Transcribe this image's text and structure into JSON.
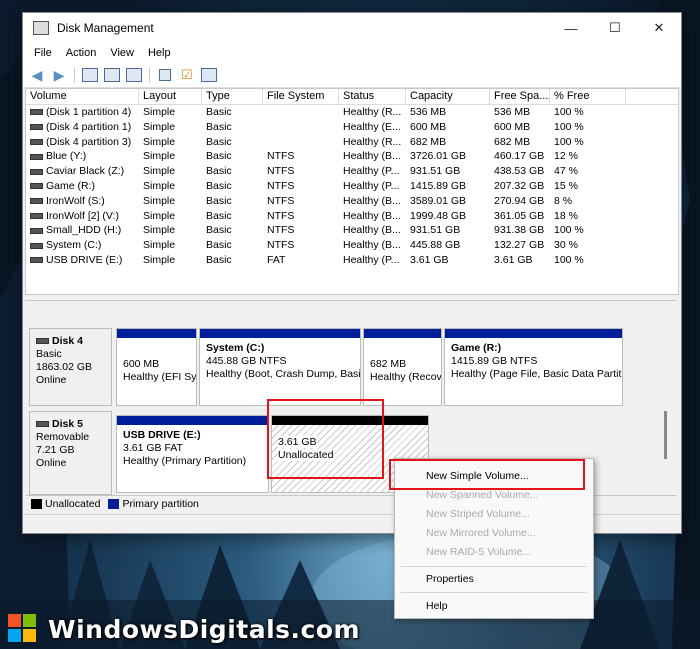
{
  "window": {
    "title": "Disk Management",
    "controls": [
      "—",
      "☐",
      "✕"
    ]
  },
  "menu": [
    "File",
    "Action",
    "View",
    "Help"
  ],
  "columns": [
    "Volume",
    "Layout",
    "Type",
    "File System",
    "Status",
    "Capacity",
    "Free Spa...",
    "% Free"
  ],
  "volumes": [
    [
      "(Disk 1 partition 4)",
      "Simple",
      "Basic",
      "",
      "Healthy (R...",
      "536 MB",
      "536 MB",
      "100 %"
    ],
    [
      "(Disk 4 partition 1)",
      "Simple",
      "Basic",
      "",
      "Healthy (E...",
      "600 MB",
      "600 MB",
      "100 %"
    ],
    [
      "(Disk 4 partition 3)",
      "Simple",
      "Basic",
      "",
      "Healthy (R...",
      "682 MB",
      "682 MB",
      "100 %"
    ],
    [
      "Blue (Y:)",
      "Simple",
      "Basic",
      "NTFS",
      "Healthy (B...",
      "3726.01 GB",
      "460.17 GB",
      "12 %"
    ],
    [
      "Caviar Black (Z:)",
      "Simple",
      "Basic",
      "NTFS",
      "Healthy (P...",
      "931.51 GB",
      "438.53 GB",
      "47 %"
    ],
    [
      "Game (R:)",
      "Simple",
      "Basic",
      "NTFS",
      "Healthy (P...",
      "1415.89 GB",
      "207.32 GB",
      "15 %"
    ],
    [
      "IronWolf (S:)",
      "Simple",
      "Basic",
      "NTFS",
      "Healthy (B...",
      "3589.01 GB",
      "270.94 GB",
      "8 %"
    ],
    [
      "IronWolf [2] (V:)",
      "Simple",
      "Basic",
      "NTFS",
      "Healthy (B...",
      "1999.48 GB",
      "361.05 GB",
      "18 %"
    ],
    [
      "Small_HDD (H:)",
      "Simple",
      "Basic",
      "NTFS",
      "Healthy (B...",
      "931.51 GB",
      "931.38 GB",
      "100 %"
    ],
    [
      "System (C:)",
      "Simple",
      "Basic",
      "NTFS",
      "Healthy (B...",
      "445.88 GB",
      "132.27 GB",
      "30 %"
    ],
    [
      "USB DRIVE (E:)",
      "Simple",
      "Basic",
      "FAT",
      "Healthy (P...",
      "3.61 GB",
      "3.61 GB",
      "100 %"
    ]
  ],
  "disk4": {
    "name": "Disk 4",
    "type": "Basic",
    "size": "1863.02 GB",
    "state": "Online",
    "partitions": [
      {
        "title": "",
        "line1": "600 MB",
        "line2": "Healthy (EFI Sy"
      },
      {
        "title": "System  (C:)",
        "line1": "445.88 GB NTFS",
        "line2": "Healthy (Boot, Crash Dump, Basi"
      },
      {
        "title": "",
        "line1": "682 MB",
        "line2": "Healthy (Recov"
      },
      {
        "title": "Game  (R:)",
        "line1": "1415.89 GB NTFS",
        "line2": "Healthy (Page File, Basic Data Partiti"
      }
    ]
  },
  "disk5": {
    "name": "Disk 5",
    "type": "Removable",
    "size": "7.21 GB",
    "state": "Online",
    "usb": {
      "title": "USB DRIVE  (E:)",
      "line1": "3.61 GB FAT",
      "line2": "Healthy (Primary Partition)"
    },
    "unalloc": {
      "line1": "3.61 GB",
      "line2": "Unallocated"
    }
  },
  "legend": {
    "unallocated": "Unallocated",
    "primary": "Primary partition"
  },
  "context_menu": {
    "new_simple": "New Simple Volume...",
    "new_spanned": "New Spanned Volume...",
    "new_striped": "New Striped Volume...",
    "new_mirrored": "New Mirrored Volume...",
    "new_raid5": "New RAID-5 Volume...",
    "properties": "Properties",
    "help": "Help"
  },
  "brand": "WindowsDigitals.com",
  "colors": {
    "primary_partition": "#001f9b",
    "unallocated": "#000000",
    "highlight": "#e0141a"
  }
}
